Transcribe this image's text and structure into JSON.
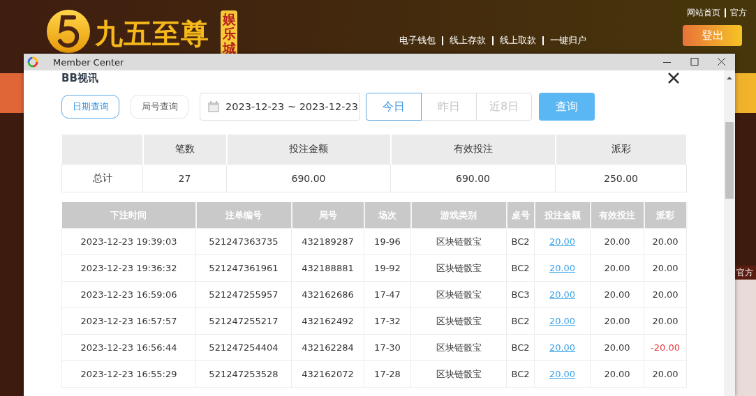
{
  "site": {
    "brand": "九五至尊",
    "brand_badge": "娱乐城",
    "top_links": [
      "网站首页",
      "官方"
    ],
    "nav_links": [
      "电子钱包",
      "线上存款",
      "线上取款",
      "一键归户"
    ],
    "logout": "登出",
    "side_text": "官方"
  },
  "window": {
    "title": "Member Center"
  },
  "section_title": "BB视讯",
  "query_tabs": [
    {
      "label": "日期查询",
      "selected": true
    },
    {
      "label": "局号查询",
      "selected": false
    }
  ],
  "date_range": {
    "value": "2023-12-23 ~ 2023-12-23"
  },
  "quick_ranges": [
    {
      "label": "今日",
      "selected": true
    },
    {
      "label": "昨日",
      "selected": false
    },
    {
      "label": "近8日",
      "selected": false
    }
  ],
  "query_button": "查询",
  "summary": {
    "columns": [
      "",
      "笔数",
      "投注金额",
      "有效投注",
      "派彩"
    ],
    "row": [
      "总计",
      "27",
      "690.00",
      "690.00",
      "250.00"
    ]
  },
  "table": {
    "columns": [
      "下注时间",
      "注单编号",
      "局号",
      "场次",
      "游戏类别",
      "桌号",
      "投注金额",
      "有效投注",
      "派彩"
    ],
    "rows": [
      {
        "time": "2023-12-23 19:39:03",
        "bet_no": "521247363735",
        "round": "432189287",
        "session": "19-96",
        "game": "区块链骰宝",
        "table": "BC2",
        "bet": "20.00",
        "valid": "20.00",
        "payout": "20.00",
        "loss": false
      },
      {
        "time": "2023-12-23 19:36:32",
        "bet_no": "521247361961",
        "round": "432188881",
        "session": "19-92",
        "game": "区块链骰宝",
        "table": "BC2",
        "bet": "20.00",
        "valid": "20.00",
        "payout": "20.00",
        "loss": false
      },
      {
        "time": "2023-12-23 16:59:06",
        "bet_no": "521247255957",
        "round": "432162686",
        "session": "17-47",
        "game": "区块链骰宝",
        "table": "BC3",
        "bet": "20.00",
        "valid": "20.00",
        "payout": "20.00",
        "loss": false
      },
      {
        "time": "2023-12-23 16:57:57",
        "bet_no": "521247255217",
        "round": "432162492",
        "session": "17-32",
        "game": "区块链骰宝",
        "table": "BC2",
        "bet": "20.00",
        "valid": "20.00",
        "payout": "20.00",
        "loss": false
      },
      {
        "time": "2023-12-23 16:56:44",
        "bet_no": "521247254404",
        "round": "432162284",
        "session": "17-30",
        "game": "区块链骰宝",
        "table": "BC2",
        "bet": "20.00",
        "valid": "20.00",
        "payout": "-20.00",
        "loss": true
      },
      {
        "time": "2023-12-23 16:55:29",
        "bet_no": "521247253528",
        "round": "432162072",
        "session": "17-28",
        "game": "区块链骰宝",
        "table": "BC2",
        "bet": "20.00",
        "valid": "20.00",
        "payout": "20.00",
        "loss": false
      }
    ]
  }
}
